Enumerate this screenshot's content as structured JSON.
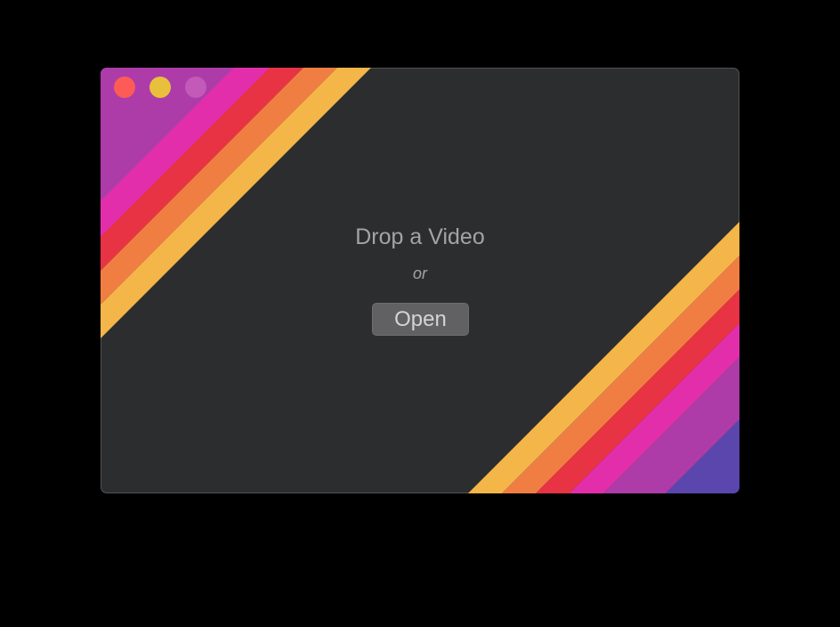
{
  "window": {
    "background": "#2c2d2f",
    "stripe_colors": [
      "#5a46ad",
      "#ad3ca9",
      "#e22eab",
      "#e83344",
      "#f07e42",
      "#f4b549"
    ]
  },
  "traffic_lights": {
    "close_color": "#fd5c56",
    "minimize_color": "#e9c03b",
    "zoom_color": "#c359b9"
  },
  "main": {
    "title": "Drop a Video",
    "separator": "or",
    "open_button_label": "Open"
  }
}
